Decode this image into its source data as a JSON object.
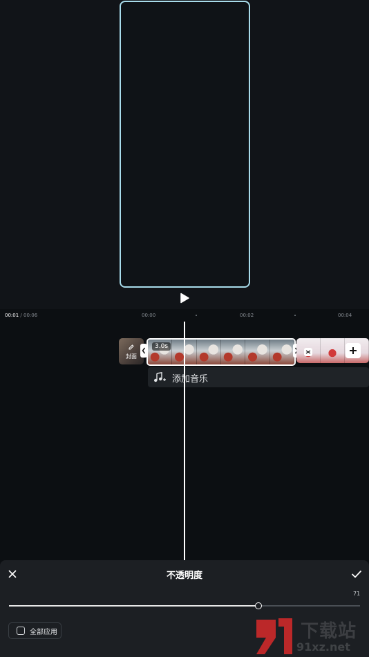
{
  "ruler": {
    "current": "00:01",
    "total": " / 00:06",
    "ticks": [
      "00:00",
      "00:02",
      "00:04"
    ]
  },
  "timeline": {
    "cover_label": "封面",
    "clip_duration": "3.0s",
    "add_music_label": "添加音乐"
  },
  "panel": {
    "title": "不透明度",
    "value": "71",
    "slider_fraction": 0.71,
    "apply_all_label": "全部应用"
  },
  "watermark": {
    "text_cn": "下载站",
    "text_url": "91xz.net"
  },
  "colors": {
    "accent_frame": "#a8dceb",
    "panel_bg": "#1c1f23",
    "watermark_red": "#d72a2a"
  },
  "icons": {
    "play": "play-icon",
    "close": "close-icon",
    "confirm": "check-icon",
    "add": "plus-icon",
    "music": "music-note-add-icon",
    "cover_edit": "edit-icon"
  }
}
